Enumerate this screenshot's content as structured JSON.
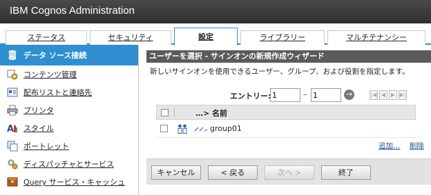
{
  "app": {
    "title": "IBM Cognos Administration"
  },
  "tabs": [
    {
      "label": "ステータス"
    },
    {
      "label": "セキュリティ"
    },
    {
      "label": "設定",
      "active": true
    },
    {
      "label": "ライブラリー"
    },
    {
      "label": "マルチテナンシー"
    }
  ],
  "sidebar": {
    "items": [
      {
        "label": "データ ソース接続",
        "icon": "database-icon",
        "active": true
      },
      {
        "label": "コンテンツ管理",
        "icon": "content-gear-icon"
      },
      {
        "label": "配布リストと連絡先",
        "icon": "address-book-icon"
      },
      {
        "label": "プリンタ",
        "icon": "printer-icon"
      },
      {
        "label": "スタイル",
        "icon": "style-icon"
      },
      {
        "label": "ポートレット",
        "icon": "portlet-icon"
      },
      {
        "label": "ディスパッチャとサービス",
        "icon": "dispatcher-icon"
      },
      {
        "label": "Query サービス・キャッシュ",
        "icon": "query-cache-icon"
      }
    ]
  },
  "wizard": {
    "title": "ユーザーを選択 - サインオンの新規作成ウィザード",
    "description": "新しいサインオンを使用できるユーザー、グループ、および役割を指定します。",
    "entry_label": "エントリー:",
    "entry_from": "1",
    "entry_to": "1",
    "entry_dash": "–",
    "go_symbol": "→",
    "grid": {
      "header": "…> 名前",
      "rows": [
        {
          "name": "group01"
        }
      ]
    },
    "actions": {
      "add": "追加…",
      "remove": "削除"
    },
    "buttons": {
      "cancel": "キャンセル",
      "back": "< 戻る",
      "next": "次へ >",
      "finish": "終了"
    }
  },
  "colors": {
    "accent": "#2f8fd0",
    "titlebar": "#2f2f2f",
    "wizard_header": "#5a5a5a"
  }
}
